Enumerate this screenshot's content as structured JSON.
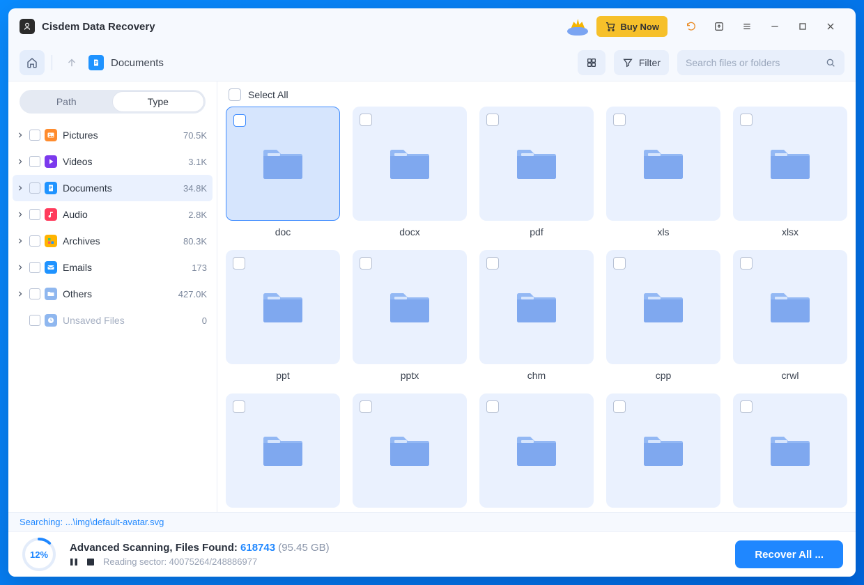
{
  "app": {
    "title": "Cisdem Data Recovery"
  },
  "titlebar": {
    "buy_now": "Buy Now"
  },
  "toolbar": {
    "breadcrumb": "Documents",
    "filter": "Filter",
    "search_placeholder": "Search files or folders"
  },
  "sidebar": {
    "seg_path": "Path",
    "seg_type": "Type",
    "rows": [
      {
        "label": "Pictures",
        "count": "70.5K",
        "icon_bg": "#ff8c2e",
        "svg": "image",
        "muted": false,
        "expandable": true
      },
      {
        "label": "Videos",
        "count": "3.1K",
        "icon_bg": "#7c3aed",
        "svg": "play",
        "muted": false,
        "expandable": true
      },
      {
        "label": "Documents",
        "count": "34.8K",
        "icon_bg": "#1f93ff",
        "svg": "doc",
        "muted": false,
        "expandable": true,
        "selected": true
      },
      {
        "label": "Audio",
        "count": "2.8K",
        "icon_bg": "#ff3b5c",
        "svg": "audio",
        "muted": false,
        "expandable": true
      },
      {
        "label": "Archives",
        "count": "80.3K",
        "icon_bg": "#ffb400",
        "svg": "grid",
        "muted": false,
        "expandable": true
      },
      {
        "label": "Emails",
        "count": "173",
        "icon_bg": "#1f93ff",
        "svg": "mail",
        "muted": false,
        "expandable": true
      },
      {
        "label": "Others",
        "count": "427.0K",
        "icon_bg": "#8fb7ef",
        "svg": "folder",
        "muted": false,
        "expandable": true
      },
      {
        "label": "Unsaved Files",
        "count": "0",
        "icon_bg": "#8fb7ef",
        "svg": "clock",
        "muted": true,
        "expandable": false
      }
    ]
  },
  "main": {
    "select_all": "Select All",
    "folders": [
      {
        "label": "doc",
        "selected": true
      },
      {
        "label": "docx",
        "selected": false
      },
      {
        "label": "pdf",
        "selected": false
      },
      {
        "label": "xls",
        "selected": false
      },
      {
        "label": "xlsx",
        "selected": false
      },
      {
        "label": "ppt",
        "selected": false
      },
      {
        "label": "pptx",
        "selected": false
      },
      {
        "label": "chm",
        "selected": false
      },
      {
        "label": "cpp",
        "selected": false
      },
      {
        "label": "crwl",
        "selected": false
      },
      {
        "label": "",
        "selected": false
      },
      {
        "label": "",
        "selected": false
      },
      {
        "label": "",
        "selected": false
      },
      {
        "label": "",
        "selected": false
      },
      {
        "label": "",
        "selected": false
      }
    ]
  },
  "footer": {
    "searching_prefix": "Searching: ",
    "searching_path": "...\\img\\default-avatar.svg",
    "scan_title": "Advanced Scanning, Files Found: ",
    "files_found": "618743",
    "size": "(95.45 GB)",
    "reading": "Reading sector: 40075264/248886977",
    "recover": "Recover All ...",
    "percent": "12%",
    "percent_num": 12
  }
}
